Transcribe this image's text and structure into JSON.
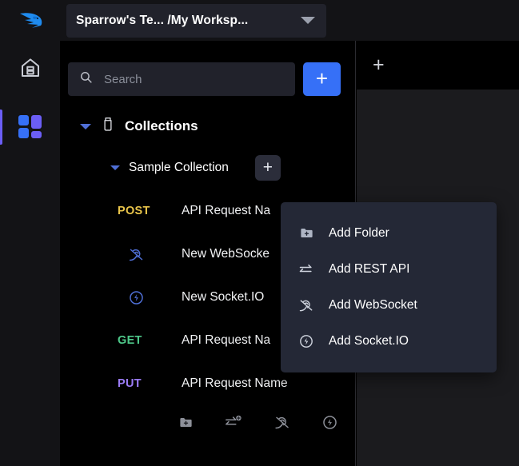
{
  "app": {
    "name": "Sparrow",
    "logo_icon": "sparrow-bird-logo",
    "accent_blue": "#3670f7",
    "accent_purple": "#6b5ef5"
  },
  "topbar": {
    "workspace_label": "Sparrow's Te... /My Worksp...",
    "dropdown_icon": "chevron-down-icon"
  },
  "activity_bar": {
    "items": [
      {
        "name": "home",
        "icon": "home-icon",
        "active": false
      },
      {
        "name": "collections",
        "icon": "grid-collections-icon",
        "active": true
      }
    ]
  },
  "explorer": {
    "search": {
      "placeholder": "Search",
      "value": "",
      "icon": "search-icon"
    },
    "add_button_label": "+",
    "collections_header": {
      "label": "Collections",
      "icon": "jar-icon",
      "expanded": true
    },
    "collection": {
      "name": "Sample Collection",
      "expanded": true,
      "add_button_label": "+"
    },
    "requests": [
      {
        "kind": "method",
        "method": "POST",
        "color": "#e8c44a",
        "name": "API Request Na"
      },
      {
        "kind": "icon",
        "icon": "websocket-icon",
        "color": "#4f6fd6",
        "name": "New WebSocke"
      },
      {
        "kind": "icon",
        "icon": "socketio-icon",
        "color": "#4f6fd6",
        "name": "New Socket.IO"
      },
      {
        "kind": "method",
        "method": "GET",
        "color": "#4ec98a",
        "name": "API Request Na"
      },
      {
        "kind": "method",
        "method": "PUT",
        "color": "#9b7cf6",
        "name": "API Request Name"
      }
    ],
    "bottom_actions": [
      {
        "name": "add-folder",
        "icon": "folder-plus-icon"
      },
      {
        "name": "add-rest-api",
        "icon": "rest-api-plus-icon"
      },
      {
        "name": "add-websocket",
        "icon": "websocket-icon"
      },
      {
        "name": "add-socketio",
        "icon": "socketio-icon"
      }
    ]
  },
  "right_panel": {
    "new_tab_label": "+"
  },
  "context_menu": {
    "items": [
      {
        "label": "Add Folder",
        "icon": "folder-plus-icon"
      },
      {
        "label": "Add REST API",
        "icon": "rest-api-icon"
      },
      {
        "label": "Add WebSocket",
        "icon": "websocket-icon"
      },
      {
        "label": "Add Socket.IO",
        "icon": "socketio-icon"
      }
    ]
  }
}
